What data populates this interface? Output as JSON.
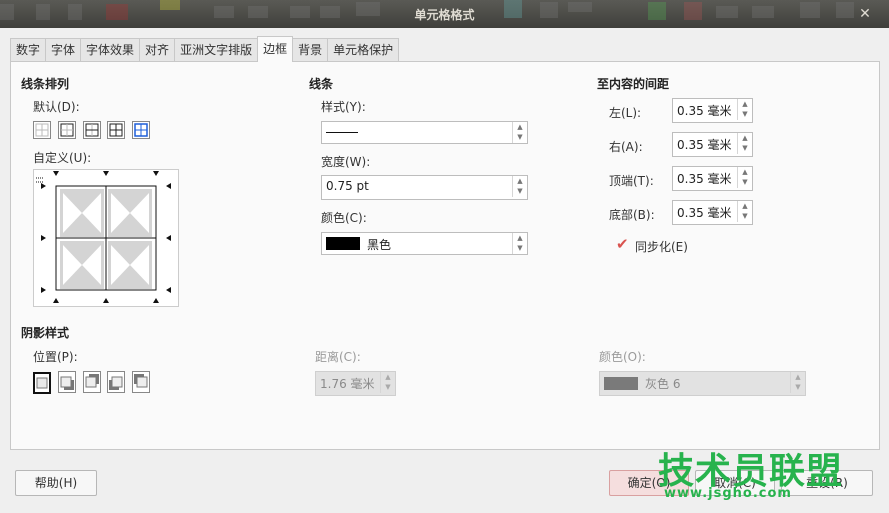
{
  "window": {
    "title": "单元格格式"
  },
  "tabs": [
    {
      "label": "数字"
    },
    {
      "label": "字体"
    },
    {
      "label": "字体效果"
    },
    {
      "label": "对齐"
    },
    {
      "label": "亚洲文字排版"
    },
    {
      "label": "边框",
      "active": true
    },
    {
      "label": "背景"
    },
    {
      "label": "单元格保护"
    }
  ],
  "line_arrangement": {
    "title": "线条排列",
    "default_label": "默认(D):",
    "user_defined_label": "自定义(U):"
  },
  "line": {
    "title": "线条",
    "style_label": "样式(Y):",
    "width_label": "宽度(W):",
    "width_value": "0.75 pt",
    "color_label": "颜色(C):",
    "color_value": "黑色",
    "color_swatch": "#000000"
  },
  "padding": {
    "title": "至内容的间距",
    "left_label": "左(L):",
    "left_value": "0.35 毫米",
    "right_label": "右(A):",
    "right_value": "0.35 毫米",
    "top_label": "顶端(T):",
    "top_value": "0.35 毫米",
    "bottom_label": "底部(B):",
    "bottom_value": "0.35 毫米",
    "sync_label": "同步化(E)",
    "sync_checked": true
  },
  "shadow": {
    "title": "阴影样式",
    "position_label": "位置(P):",
    "distance_label": "距离(C):",
    "distance_value": "1.76 毫米",
    "color_label": "颜色(O):",
    "color_value": "灰色 6",
    "color_swatch": "#7a7a7a"
  },
  "buttons": {
    "help": "帮助(H)",
    "ok": "确定(O)",
    "cancel": "取消(C)",
    "reset": "重设(R)"
  },
  "watermark": {
    "text": "技术员联盟",
    "url": "www.jsgho.com"
  }
}
